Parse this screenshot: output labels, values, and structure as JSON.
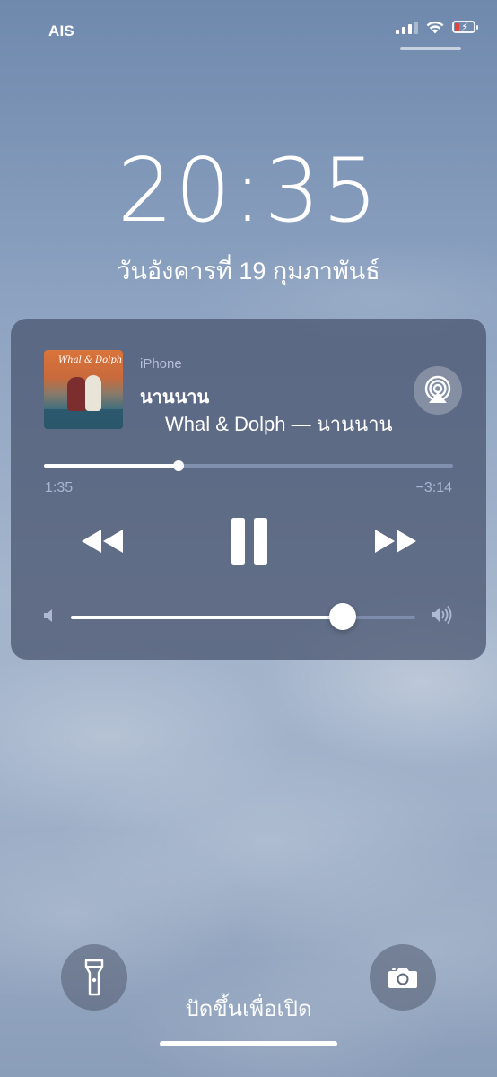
{
  "status_bar": {
    "carrier": "AIS",
    "signal_bars": 4,
    "signal_bars_active": 3,
    "battery_level_percent": 15,
    "battery_color": "#e0453c",
    "charging": true
  },
  "lock": {
    "time": "20:35",
    "date": "วันอังคารที่ 19 กุมภาพันธ์"
  },
  "now_playing": {
    "source": "iPhone",
    "title": "นานนาน",
    "subtitle": "Whal & Dolph — นานนาน",
    "artwork_text": "Whal & Dolph",
    "elapsed": "1:35",
    "remaining": "−3:14",
    "progress_fraction": 0.33,
    "volume_fraction": 0.79,
    "icons": {
      "airplay": "airplay-icon",
      "rewind": "rewind-icon",
      "pause": "pause-icon",
      "forward": "fast-forward-icon",
      "volume_low": "speaker-low-icon",
      "volume_high": "speaker-high-icon"
    }
  },
  "bottom": {
    "unlock_hint": "ปัดขึ้นเพื่อเปิด",
    "left_icon": "flashlight-icon",
    "right_icon": "camera-icon"
  }
}
